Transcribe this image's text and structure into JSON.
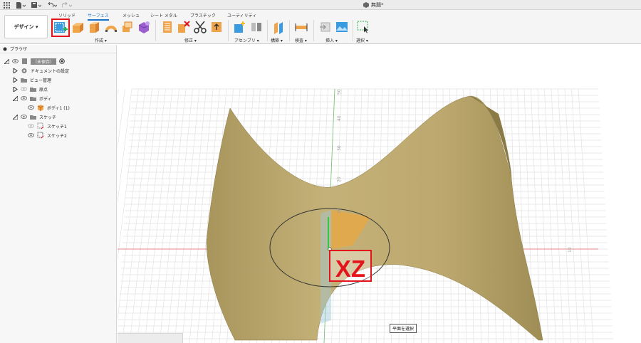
{
  "title_bar": {
    "document_title": "無題*"
  },
  "workspace": {
    "label": "デザイン ▾"
  },
  "tabs": [
    {
      "label": "ソリッド",
      "active": false
    },
    {
      "label": "サーフェス",
      "active": true
    },
    {
      "label": "メッシュ",
      "active": false
    },
    {
      "label": "シート メタル",
      "active": false
    },
    {
      "label": "プラスチック",
      "active": false
    },
    {
      "label": "ユーティリティ",
      "active": false
    }
  ],
  "ribbon_groups": {
    "create": "作成 ▾",
    "modify": "修正 ▾",
    "assemble": "アセンブリ ▾",
    "construct": "構築 ▾",
    "inspect": "検査 ▾",
    "insert": "挿入 ▾",
    "select": "選択 ▾"
  },
  "browser": {
    "title": "ブラウザ",
    "items": {
      "root": "（未保存）",
      "doc_settings": "ドキュメントの設定",
      "view_mgmt": "ビュー管理",
      "origin": "原点",
      "bodies": "ボディ",
      "body1": "ボディ1 (1)",
      "sketches": "スケッチ",
      "sketch1": "スケッチ1",
      "sketch2": "スケッチ2"
    }
  },
  "viewport": {
    "plane_label": "XZ",
    "status_tip": "平面を選択",
    "axis_ticks_x": [
      "10"
    ],
    "axis_ticks_y": [
      "10",
      "20",
      "30",
      "40",
      "50"
    ]
  },
  "colors": {
    "surface": "#c4b178",
    "surface_dark": "#9e8d55",
    "highlight_red": "#e3141b",
    "accent_blue": "#1a73c9",
    "plane_orange": "#e9a844"
  }
}
